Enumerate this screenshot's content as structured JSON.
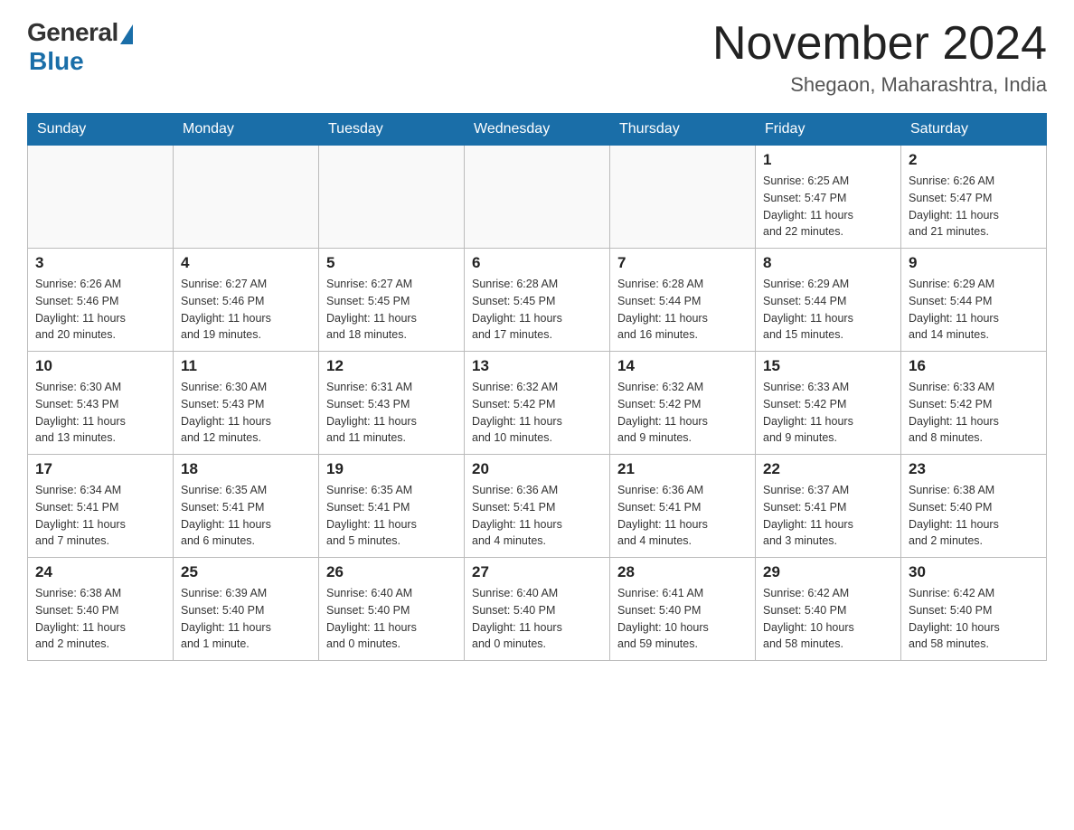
{
  "header": {
    "logo_general": "General",
    "logo_blue": "Blue",
    "month_title": "November 2024",
    "location": "Shegaon, Maharashtra, India"
  },
  "days_of_week": [
    "Sunday",
    "Monday",
    "Tuesday",
    "Wednesday",
    "Thursday",
    "Friday",
    "Saturday"
  ],
  "weeks": [
    [
      {
        "day": "",
        "info": ""
      },
      {
        "day": "",
        "info": ""
      },
      {
        "day": "",
        "info": ""
      },
      {
        "day": "",
        "info": ""
      },
      {
        "day": "",
        "info": ""
      },
      {
        "day": "1",
        "info": "Sunrise: 6:25 AM\nSunset: 5:47 PM\nDaylight: 11 hours\nand 22 minutes."
      },
      {
        "day": "2",
        "info": "Sunrise: 6:26 AM\nSunset: 5:47 PM\nDaylight: 11 hours\nand 21 minutes."
      }
    ],
    [
      {
        "day": "3",
        "info": "Sunrise: 6:26 AM\nSunset: 5:46 PM\nDaylight: 11 hours\nand 20 minutes."
      },
      {
        "day": "4",
        "info": "Sunrise: 6:27 AM\nSunset: 5:46 PM\nDaylight: 11 hours\nand 19 minutes."
      },
      {
        "day": "5",
        "info": "Sunrise: 6:27 AM\nSunset: 5:45 PM\nDaylight: 11 hours\nand 18 minutes."
      },
      {
        "day": "6",
        "info": "Sunrise: 6:28 AM\nSunset: 5:45 PM\nDaylight: 11 hours\nand 17 minutes."
      },
      {
        "day": "7",
        "info": "Sunrise: 6:28 AM\nSunset: 5:44 PM\nDaylight: 11 hours\nand 16 minutes."
      },
      {
        "day": "8",
        "info": "Sunrise: 6:29 AM\nSunset: 5:44 PM\nDaylight: 11 hours\nand 15 minutes."
      },
      {
        "day": "9",
        "info": "Sunrise: 6:29 AM\nSunset: 5:44 PM\nDaylight: 11 hours\nand 14 minutes."
      }
    ],
    [
      {
        "day": "10",
        "info": "Sunrise: 6:30 AM\nSunset: 5:43 PM\nDaylight: 11 hours\nand 13 minutes."
      },
      {
        "day": "11",
        "info": "Sunrise: 6:30 AM\nSunset: 5:43 PM\nDaylight: 11 hours\nand 12 minutes."
      },
      {
        "day": "12",
        "info": "Sunrise: 6:31 AM\nSunset: 5:43 PM\nDaylight: 11 hours\nand 11 minutes."
      },
      {
        "day": "13",
        "info": "Sunrise: 6:32 AM\nSunset: 5:42 PM\nDaylight: 11 hours\nand 10 minutes."
      },
      {
        "day": "14",
        "info": "Sunrise: 6:32 AM\nSunset: 5:42 PM\nDaylight: 11 hours\nand 9 minutes."
      },
      {
        "day": "15",
        "info": "Sunrise: 6:33 AM\nSunset: 5:42 PM\nDaylight: 11 hours\nand 9 minutes."
      },
      {
        "day": "16",
        "info": "Sunrise: 6:33 AM\nSunset: 5:42 PM\nDaylight: 11 hours\nand 8 minutes."
      }
    ],
    [
      {
        "day": "17",
        "info": "Sunrise: 6:34 AM\nSunset: 5:41 PM\nDaylight: 11 hours\nand 7 minutes."
      },
      {
        "day": "18",
        "info": "Sunrise: 6:35 AM\nSunset: 5:41 PM\nDaylight: 11 hours\nand 6 minutes."
      },
      {
        "day": "19",
        "info": "Sunrise: 6:35 AM\nSunset: 5:41 PM\nDaylight: 11 hours\nand 5 minutes."
      },
      {
        "day": "20",
        "info": "Sunrise: 6:36 AM\nSunset: 5:41 PM\nDaylight: 11 hours\nand 4 minutes."
      },
      {
        "day": "21",
        "info": "Sunrise: 6:36 AM\nSunset: 5:41 PM\nDaylight: 11 hours\nand 4 minutes."
      },
      {
        "day": "22",
        "info": "Sunrise: 6:37 AM\nSunset: 5:41 PM\nDaylight: 11 hours\nand 3 minutes."
      },
      {
        "day": "23",
        "info": "Sunrise: 6:38 AM\nSunset: 5:40 PM\nDaylight: 11 hours\nand 2 minutes."
      }
    ],
    [
      {
        "day": "24",
        "info": "Sunrise: 6:38 AM\nSunset: 5:40 PM\nDaylight: 11 hours\nand 2 minutes."
      },
      {
        "day": "25",
        "info": "Sunrise: 6:39 AM\nSunset: 5:40 PM\nDaylight: 11 hours\nand 1 minute."
      },
      {
        "day": "26",
        "info": "Sunrise: 6:40 AM\nSunset: 5:40 PM\nDaylight: 11 hours\nand 0 minutes."
      },
      {
        "day": "27",
        "info": "Sunrise: 6:40 AM\nSunset: 5:40 PM\nDaylight: 11 hours\nand 0 minutes."
      },
      {
        "day": "28",
        "info": "Sunrise: 6:41 AM\nSunset: 5:40 PM\nDaylight: 10 hours\nand 59 minutes."
      },
      {
        "day": "29",
        "info": "Sunrise: 6:42 AM\nSunset: 5:40 PM\nDaylight: 10 hours\nand 58 minutes."
      },
      {
        "day": "30",
        "info": "Sunrise: 6:42 AM\nSunset: 5:40 PM\nDaylight: 10 hours\nand 58 minutes."
      }
    ]
  ]
}
